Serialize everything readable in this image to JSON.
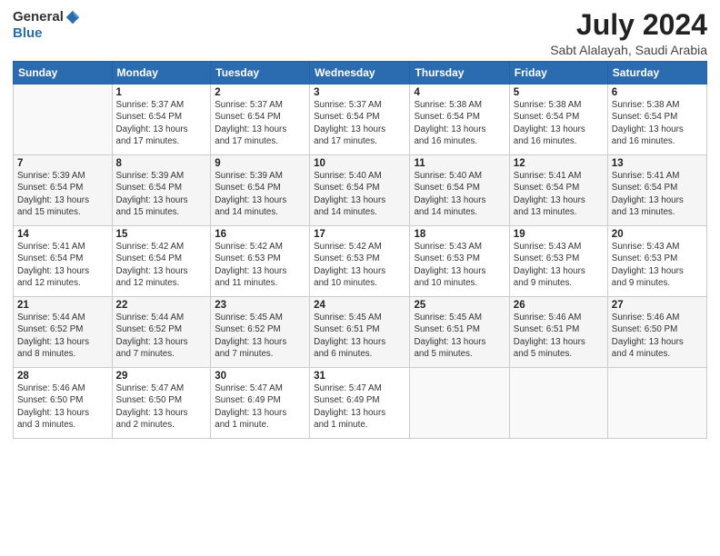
{
  "logo": {
    "text_general": "General",
    "text_blue": "Blue"
  },
  "title": {
    "month_year": "July 2024",
    "location": "Sabt Alalayah, Saudi Arabia"
  },
  "headers": [
    "Sunday",
    "Monday",
    "Tuesday",
    "Wednesday",
    "Thursday",
    "Friday",
    "Saturday"
  ],
  "weeks": [
    [
      {
        "day": "",
        "info": ""
      },
      {
        "day": "1",
        "info": "Sunrise: 5:37 AM\nSunset: 6:54 PM\nDaylight: 13 hours\nand 17 minutes."
      },
      {
        "day": "2",
        "info": "Sunrise: 5:37 AM\nSunset: 6:54 PM\nDaylight: 13 hours\nand 17 minutes."
      },
      {
        "day": "3",
        "info": "Sunrise: 5:37 AM\nSunset: 6:54 PM\nDaylight: 13 hours\nand 17 minutes."
      },
      {
        "day": "4",
        "info": "Sunrise: 5:38 AM\nSunset: 6:54 PM\nDaylight: 13 hours\nand 16 minutes."
      },
      {
        "day": "5",
        "info": "Sunrise: 5:38 AM\nSunset: 6:54 PM\nDaylight: 13 hours\nand 16 minutes."
      },
      {
        "day": "6",
        "info": "Sunrise: 5:38 AM\nSunset: 6:54 PM\nDaylight: 13 hours\nand 16 minutes."
      }
    ],
    [
      {
        "day": "7",
        "info": "Sunrise: 5:39 AM\nSunset: 6:54 PM\nDaylight: 13 hours\nand 15 minutes."
      },
      {
        "day": "8",
        "info": "Sunrise: 5:39 AM\nSunset: 6:54 PM\nDaylight: 13 hours\nand 15 minutes."
      },
      {
        "day": "9",
        "info": "Sunrise: 5:39 AM\nSunset: 6:54 PM\nDaylight: 13 hours\nand 14 minutes."
      },
      {
        "day": "10",
        "info": "Sunrise: 5:40 AM\nSunset: 6:54 PM\nDaylight: 13 hours\nand 14 minutes."
      },
      {
        "day": "11",
        "info": "Sunrise: 5:40 AM\nSunset: 6:54 PM\nDaylight: 13 hours\nand 14 minutes."
      },
      {
        "day": "12",
        "info": "Sunrise: 5:41 AM\nSunset: 6:54 PM\nDaylight: 13 hours\nand 13 minutes."
      },
      {
        "day": "13",
        "info": "Sunrise: 5:41 AM\nSunset: 6:54 PM\nDaylight: 13 hours\nand 13 minutes."
      }
    ],
    [
      {
        "day": "14",
        "info": "Sunrise: 5:41 AM\nSunset: 6:54 PM\nDaylight: 13 hours\nand 12 minutes."
      },
      {
        "day": "15",
        "info": "Sunrise: 5:42 AM\nSunset: 6:54 PM\nDaylight: 13 hours\nand 12 minutes."
      },
      {
        "day": "16",
        "info": "Sunrise: 5:42 AM\nSunset: 6:53 PM\nDaylight: 13 hours\nand 11 minutes."
      },
      {
        "day": "17",
        "info": "Sunrise: 5:42 AM\nSunset: 6:53 PM\nDaylight: 13 hours\nand 10 minutes."
      },
      {
        "day": "18",
        "info": "Sunrise: 5:43 AM\nSunset: 6:53 PM\nDaylight: 13 hours\nand 10 minutes."
      },
      {
        "day": "19",
        "info": "Sunrise: 5:43 AM\nSunset: 6:53 PM\nDaylight: 13 hours\nand 9 minutes."
      },
      {
        "day": "20",
        "info": "Sunrise: 5:43 AM\nSunset: 6:53 PM\nDaylight: 13 hours\nand 9 minutes."
      }
    ],
    [
      {
        "day": "21",
        "info": "Sunrise: 5:44 AM\nSunset: 6:52 PM\nDaylight: 13 hours\nand 8 minutes."
      },
      {
        "day": "22",
        "info": "Sunrise: 5:44 AM\nSunset: 6:52 PM\nDaylight: 13 hours\nand 7 minutes."
      },
      {
        "day": "23",
        "info": "Sunrise: 5:45 AM\nSunset: 6:52 PM\nDaylight: 13 hours\nand 7 minutes."
      },
      {
        "day": "24",
        "info": "Sunrise: 5:45 AM\nSunset: 6:51 PM\nDaylight: 13 hours\nand 6 minutes."
      },
      {
        "day": "25",
        "info": "Sunrise: 5:45 AM\nSunset: 6:51 PM\nDaylight: 13 hours\nand 5 minutes."
      },
      {
        "day": "26",
        "info": "Sunrise: 5:46 AM\nSunset: 6:51 PM\nDaylight: 13 hours\nand 5 minutes."
      },
      {
        "day": "27",
        "info": "Sunrise: 5:46 AM\nSunset: 6:50 PM\nDaylight: 13 hours\nand 4 minutes."
      }
    ],
    [
      {
        "day": "28",
        "info": "Sunrise: 5:46 AM\nSunset: 6:50 PM\nDaylight: 13 hours\nand 3 minutes."
      },
      {
        "day": "29",
        "info": "Sunrise: 5:47 AM\nSunset: 6:50 PM\nDaylight: 13 hours\nand 2 minutes."
      },
      {
        "day": "30",
        "info": "Sunrise: 5:47 AM\nSunset: 6:49 PM\nDaylight: 13 hours\nand 1 minute."
      },
      {
        "day": "31",
        "info": "Sunrise: 5:47 AM\nSunset: 6:49 PM\nDaylight: 13 hours\nand 1 minute."
      },
      {
        "day": "",
        "info": ""
      },
      {
        "day": "",
        "info": ""
      },
      {
        "day": "",
        "info": ""
      }
    ]
  ]
}
